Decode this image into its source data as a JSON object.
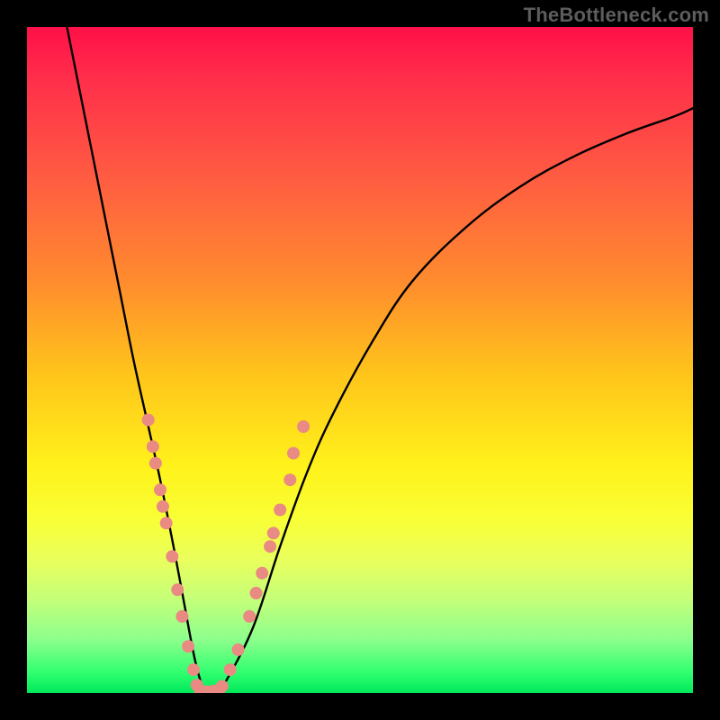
{
  "watermark": "TheBottleneck.com",
  "chart_data": {
    "type": "line",
    "title": "",
    "xlabel": "",
    "ylabel": "",
    "xlim": [
      0,
      100
    ],
    "ylim": [
      0,
      100
    ],
    "grid": false,
    "legend": false,
    "series": [
      {
        "name": "curve",
        "color": "#000000",
        "x": [
          6,
          8,
          10,
          12,
          14,
          16,
          18,
          20,
          22,
          23.5,
          25,
          26,
          27,
          28.5,
          30,
          34,
          38,
          42,
          46,
          52,
          58,
          66,
          74,
          82,
          90,
          97,
          100
        ],
        "y": [
          100,
          90,
          80,
          70,
          60,
          50,
          41,
          32,
          22,
          14,
          6,
          2,
          0,
          0,
          2,
          10,
          22,
          33,
          42,
          53,
          62,
          70,
          76,
          80.5,
          84,
          86.5,
          87.8
        ]
      }
    ],
    "markers": {
      "color": "#e98a83",
      "radius_px": 7,
      "points": [
        {
          "x": 18.2,
          "y": 41.0
        },
        {
          "x": 18.9,
          "y": 37.0
        },
        {
          "x": 19.3,
          "y": 34.5
        },
        {
          "x": 20.0,
          "y": 30.5
        },
        {
          "x": 20.4,
          "y": 28.0
        },
        {
          "x": 20.9,
          "y": 25.5
        },
        {
          "x": 21.8,
          "y": 20.5
        },
        {
          "x": 22.6,
          "y": 15.5
        },
        {
          "x": 23.3,
          "y": 11.5
        },
        {
          "x": 24.2,
          "y": 7.0
        },
        {
          "x": 25.0,
          "y": 3.5
        },
        {
          "x": 25.5,
          "y": 1.2
        },
        {
          "x": 26.0,
          "y": 0.4
        },
        {
          "x": 27.0,
          "y": 0.2
        },
        {
          "x": 28.0,
          "y": 0.3
        },
        {
          "x": 28.8,
          "y": 0.4
        },
        {
          "x": 29.3,
          "y": 1.0
        },
        {
          "x": 30.5,
          "y": 3.5
        },
        {
          "x": 31.7,
          "y": 6.5
        },
        {
          "x": 33.4,
          "y": 11.5
        },
        {
          "x": 34.4,
          "y": 15.0
        },
        {
          "x": 35.3,
          "y": 18.0
        },
        {
          "x": 36.5,
          "y": 22.0
        },
        {
          "x": 37.0,
          "y": 24.0
        },
        {
          "x": 38.0,
          "y": 27.5
        },
        {
          "x": 39.5,
          "y": 32.0
        },
        {
          "x": 40.0,
          "y": 36.0
        },
        {
          "x": 41.5,
          "y": 40.0
        }
      ]
    }
  }
}
